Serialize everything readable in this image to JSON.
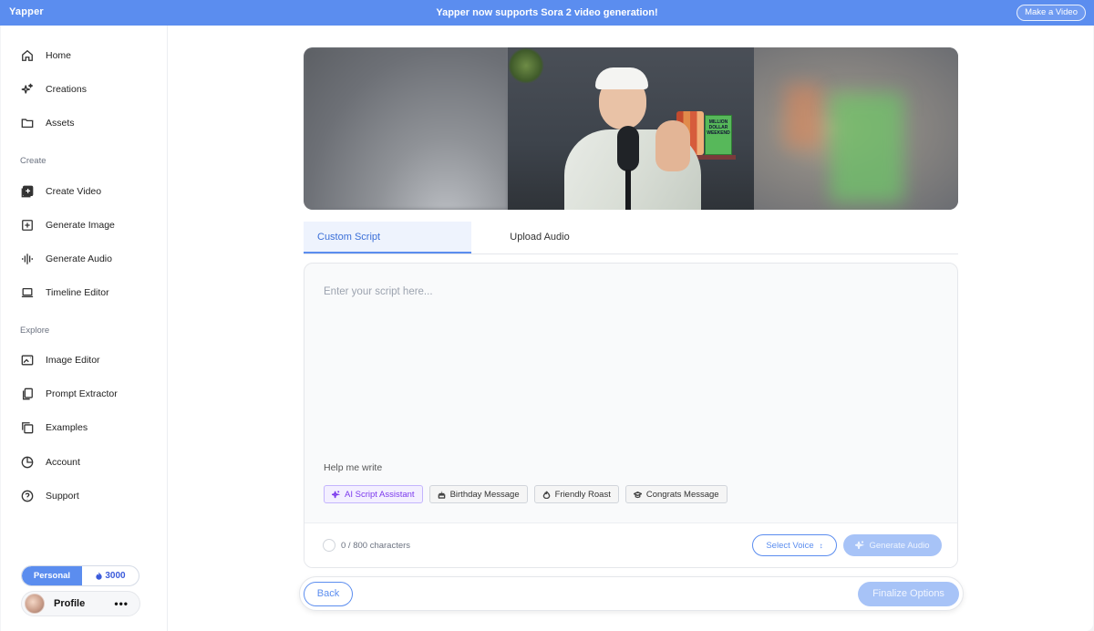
{
  "topbar": {
    "brand": "Yapper",
    "announcement": "Yapper now supports Sora 2 video generation!",
    "make_video_label": "Make a Video"
  },
  "sidebar": {
    "items": [
      {
        "label": "Home",
        "icon": "home-icon"
      },
      {
        "label": "Creations",
        "icon": "sparkles-icon"
      },
      {
        "label": "Assets",
        "icon": "folder-icon"
      }
    ],
    "create_label": "Create",
    "create_items": [
      {
        "label": "Create Video",
        "icon": "add-video-icon"
      },
      {
        "label": "Generate Image",
        "icon": "image-plus-icon"
      },
      {
        "label": "Generate Audio",
        "icon": "audio-wave-icon"
      },
      {
        "label": "Timeline Editor",
        "icon": "laptop-icon"
      }
    ],
    "explore_label": "Explore",
    "explore_items": [
      {
        "label": "Image Editor",
        "icon": "image-icon"
      },
      {
        "label": "Prompt Extractor",
        "icon": "copy-icon"
      },
      {
        "label": "Examples",
        "icon": "stack-icon"
      },
      {
        "label": "Account",
        "icon": "pie-chart-icon"
      },
      {
        "label": "Support",
        "icon": "help-circle-icon"
      }
    ],
    "plan": "Personal",
    "credits": "3000",
    "profile_name": "Profile",
    "profile_more": "•••"
  },
  "hero": {
    "book_title": "MILLION DOLLAR WEEKEND"
  },
  "tabs": {
    "custom_script": "Custom Script",
    "upload_audio": "Upload Audio"
  },
  "editor": {
    "placeholder": "Enter your script here...",
    "help_label": "Help me write",
    "chips": [
      "AI Script Assistant",
      "Birthday Message",
      "Friendly Roast",
      "Congrats Message"
    ],
    "char_count": "0 / 800 characters",
    "select_voice": "Select Voice",
    "generate_audio": "Generate Audio"
  },
  "actions": {
    "back": "Back",
    "finalize": "Finalize Options"
  },
  "colors": {
    "accent": "#5b8def",
    "accent_disabled": "#a7c3f7",
    "ai_purple": "#7c3aed"
  }
}
